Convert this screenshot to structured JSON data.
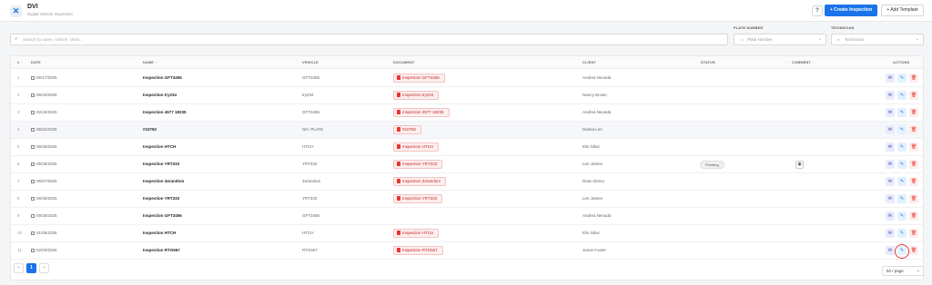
{
  "header": {
    "logo_glyph": "✕",
    "title": "DVI",
    "subtitle": "Digital Vehicle Inspection",
    "help_glyph": "?",
    "create_label": "+ Create Inspection",
    "add_template_label": "+ Add Template"
  },
  "filters": {
    "search_placeholder": "Search by name, vehicle, client...",
    "plate_label": "PLATE NUMBER",
    "plate_placeholder": "Plate Number",
    "tech_label": "TECHNICIAN",
    "tech_placeholder": "Technician"
  },
  "table": {
    "columns": {
      "num": "#",
      "date": "DATE",
      "name": "NAME ↑",
      "vehicle": "VEHICLE",
      "document": "DOCUMENT",
      "client": "CLIENT",
      "status": "STATUS",
      "comment": "COMMENT",
      "actions": "ACTIONS"
    },
    "rows": [
      {
        "num": "1",
        "date": "06/17/2025",
        "name": "Inspection GFT3456",
        "vehicle": "GFT3456",
        "document": "Inspection GFT3456",
        "client": "Andrea Nevada",
        "status": "",
        "comment": false,
        "highlight": false
      },
      {
        "num": "2",
        "date": "06/20/2025",
        "name": "Inspection try234",
        "vehicle": "try234",
        "document": "Inspection try234",
        "client": "Nancy Brown",
        "status": "",
        "comment": false,
        "highlight": false
      },
      {
        "num": "3",
        "date": "02/18/2025",
        "name": "Inspection 4577 18235",
        "vehicle": "GFT3456",
        "document": "Inspection 4577 18235",
        "client": "Andrea Nevada",
        "status": "",
        "comment": false,
        "highlight": false
      },
      {
        "num": "4",
        "date": "06/22/2025",
        "name": "#10792",
        "vehicle": "NO. PLATE",
        "document": "#10792",
        "client": "Danka Len",
        "status": "",
        "comment": false,
        "highlight": true
      },
      {
        "num": "5",
        "date": "06/25/2025",
        "name": "Inspection HTCH",
        "vehicle": "HTCH",
        "document": "Inspection HTCH",
        "client": "Elis Nikur",
        "status": "",
        "comment": false,
        "highlight": false
      },
      {
        "num": "6",
        "date": "06/26/2025",
        "name": "Inspection YRT333",
        "vehicle": "YRT333",
        "document": "Inspection YRT333",
        "client": "Len James",
        "status": "Pending",
        "comment": true,
        "highlight": false
      },
      {
        "num": "7",
        "date": "06/27/2025",
        "name": "Inspection 34random",
        "vehicle": "34random",
        "document": "Inspection 34random",
        "client": "Dean Demo",
        "status": "",
        "comment": false,
        "highlight": false
      },
      {
        "num": "8",
        "date": "06/30/2025",
        "name": "Inspection YRT333",
        "vehicle": "YRT333",
        "document": "Inspection YRT333",
        "client": "Len James",
        "status": "",
        "comment": false,
        "highlight": false
      },
      {
        "num": "9",
        "date": "09/30/2025",
        "name": "Inspection GFT3456",
        "vehicle": "GFT3456",
        "document": "",
        "client": "Andrea Nevada",
        "status": "",
        "comment": false,
        "highlight": false
      },
      {
        "num": "10",
        "date": "01/05/2026",
        "name": "Inspection HTCH",
        "vehicle": "HTCH",
        "document": "Inspection HTCH",
        "client": "Elis Nikur",
        "status": "",
        "comment": false,
        "highlight": false
      },
      {
        "num": "11",
        "date": "02/20/2026",
        "name": "Inspection RTG567",
        "vehicle": "RTG567",
        "document": "Inspection RTG567",
        "client": "Jamie Foster",
        "status": "",
        "comment": false,
        "highlight": false
      }
    ]
  },
  "pagination": {
    "prev": "«",
    "current": "1",
    "next": "»",
    "page_size": "50 / page"
  },
  "colors": {
    "accent": "#1a73e8",
    "danger": "#e53935"
  }
}
